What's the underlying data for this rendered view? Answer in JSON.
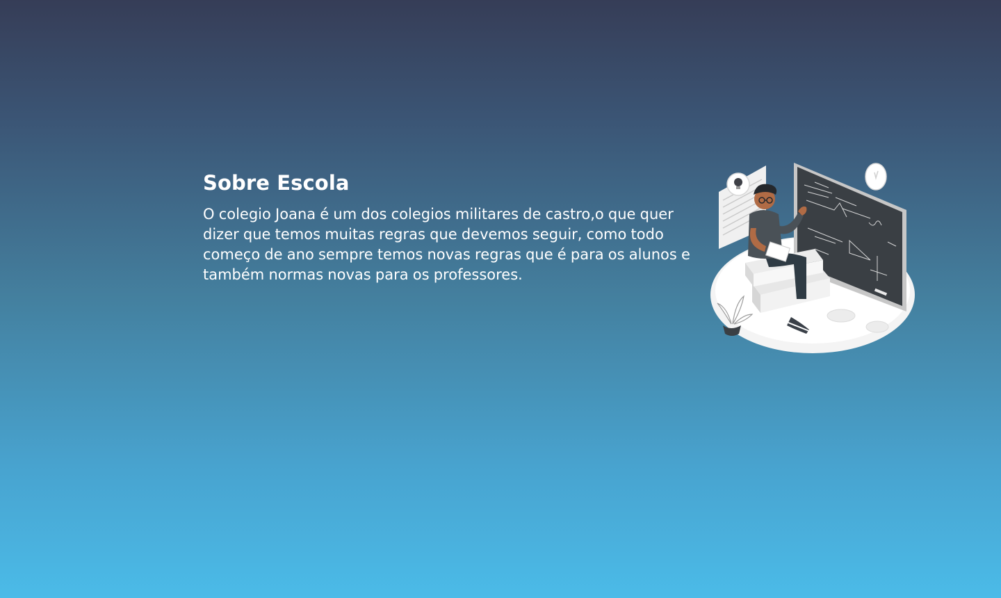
{
  "about": {
    "title": "Sobre Escola",
    "description": "O colegio Joana é um dos colegios militares de castro,o que quer dizer que temos muitas regras que devemos seguir, como todo começo de ano sempre temos novas regras que é para os alunos e também normas novas para os professores.",
    "illustration_icon": "teacher-chalkboard-illustration"
  },
  "colors": {
    "background_top": "#363d57",
    "background_bottom": "#4bbbe8",
    "text": "#ffffff"
  }
}
